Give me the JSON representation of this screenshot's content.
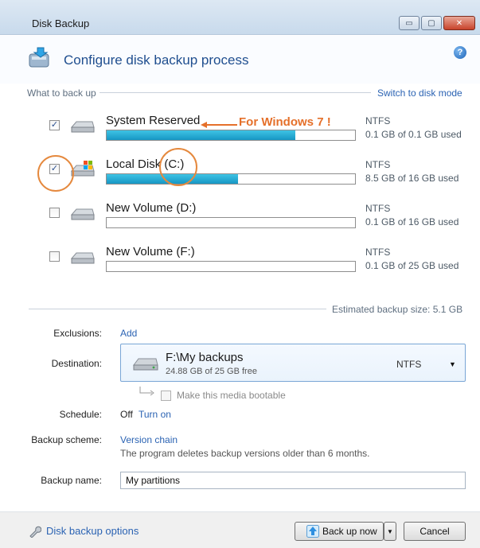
{
  "window": {
    "title": "Disk Backup",
    "minimize_glyph": "▭",
    "maximize_glyph": "▢",
    "close_glyph": "✕"
  },
  "header": {
    "title": "Configure disk backup process",
    "help_glyph": "?"
  },
  "what_to_back_up": {
    "label": "What to back up",
    "switch_link": "Switch to disk mode",
    "disks": [
      {
        "name": "System Reserved",
        "checked": true,
        "fs": "NTFS",
        "usage": "0.1 GB of 0.1 GB used",
        "fill_fraction": 0.76,
        "icon": "drive-icon"
      },
      {
        "name": "Local Disk (C:)",
        "checked": true,
        "fs": "NTFS",
        "usage": "8.5 GB of 16 GB used",
        "fill_fraction": 0.53,
        "icon": "windows-drive-icon"
      },
      {
        "name": "New Volume (D:)",
        "checked": false,
        "fs": "NTFS",
        "usage": "0.1 GB of 16 GB used",
        "fill_fraction": 0.0,
        "icon": "drive-icon"
      },
      {
        "name": "New Volume (F:)",
        "checked": false,
        "fs": "NTFS",
        "usage": "0.1 GB of 25 GB used",
        "fill_fraction": 0.0,
        "icon": "drive-icon"
      }
    ],
    "annotation": "For Windows 7 !"
  },
  "estimated_size": "Estimated backup size: 5.1 GB",
  "exclusions": {
    "label": "Exclusions:",
    "link": "Add"
  },
  "destination": {
    "label": "Destination:",
    "path": "F:\\My backups",
    "free": "24.88 GB of 25 GB free",
    "fs": "NTFS",
    "bootable_label": "Make this media bootable"
  },
  "schedule": {
    "label": "Schedule:",
    "status": "Off",
    "link": "Turn on"
  },
  "backup_scheme": {
    "label": "Backup scheme:",
    "link": "Version chain",
    "description": "The program deletes backup versions older than 6 months."
  },
  "backup_name": {
    "label": "Backup name:",
    "value": "My partitions"
  },
  "footer": {
    "options_link": "Disk backup options",
    "backup_button": "Back up now",
    "cancel_button": "Cancel"
  },
  "colors": {
    "accent": "#2b63b3",
    "bar_fill": "#1797c4",
    "annotation": "#e5702a"
  }
}
